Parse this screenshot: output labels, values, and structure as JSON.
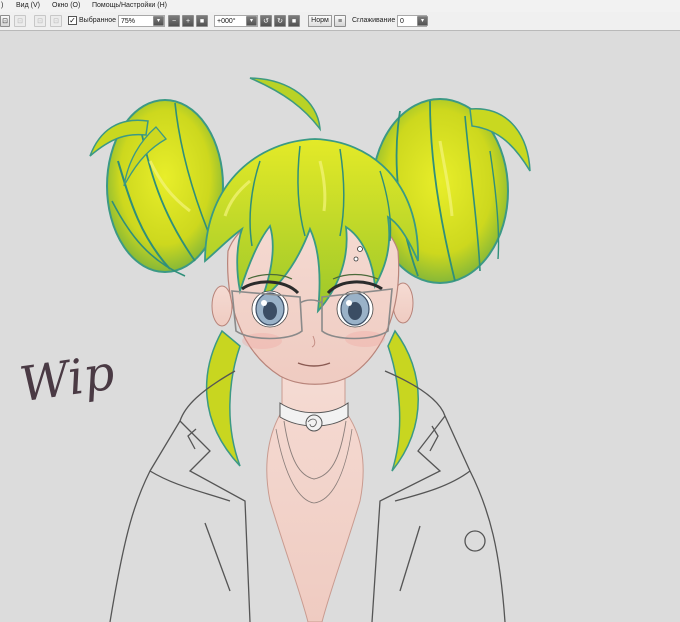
{
  "menu": {
    "items": [
      {
        "label": ")"
      },
      {
        "label": "Вид (V)"
      },
      {
        "label": "Окно (O)"
      },
      {
        "label": "Помощь/Настройки (H)"
      }
    ]
  },
  "toolbar": {
    "selected_label": "Выбранное",
    "selected_checked": true,
    "zoom_value": "75%",
    "rotation_value": "+000°",
    "blend_button": "Норм",
    "smoothing_label": "Сглаживание",
    "smoothing_value": "0"
  },
  "icons": {
    "minus": "−",
    "plus": "+",
    "square": "■",
    "check": "✓",
    "dropdown": "▾"
  },
  "canvas": {
    "annotation": "Wip",
    "background_color": "#dcdcdc",
    "hair_color": "#d6e020",
    "hair_shadow_color": "#2f9a86",
    "skin_color": "#f3d4cc",
    "line_color": "#4a4a4a",
    "eye_color": "#9ab2c8"
  }
}
